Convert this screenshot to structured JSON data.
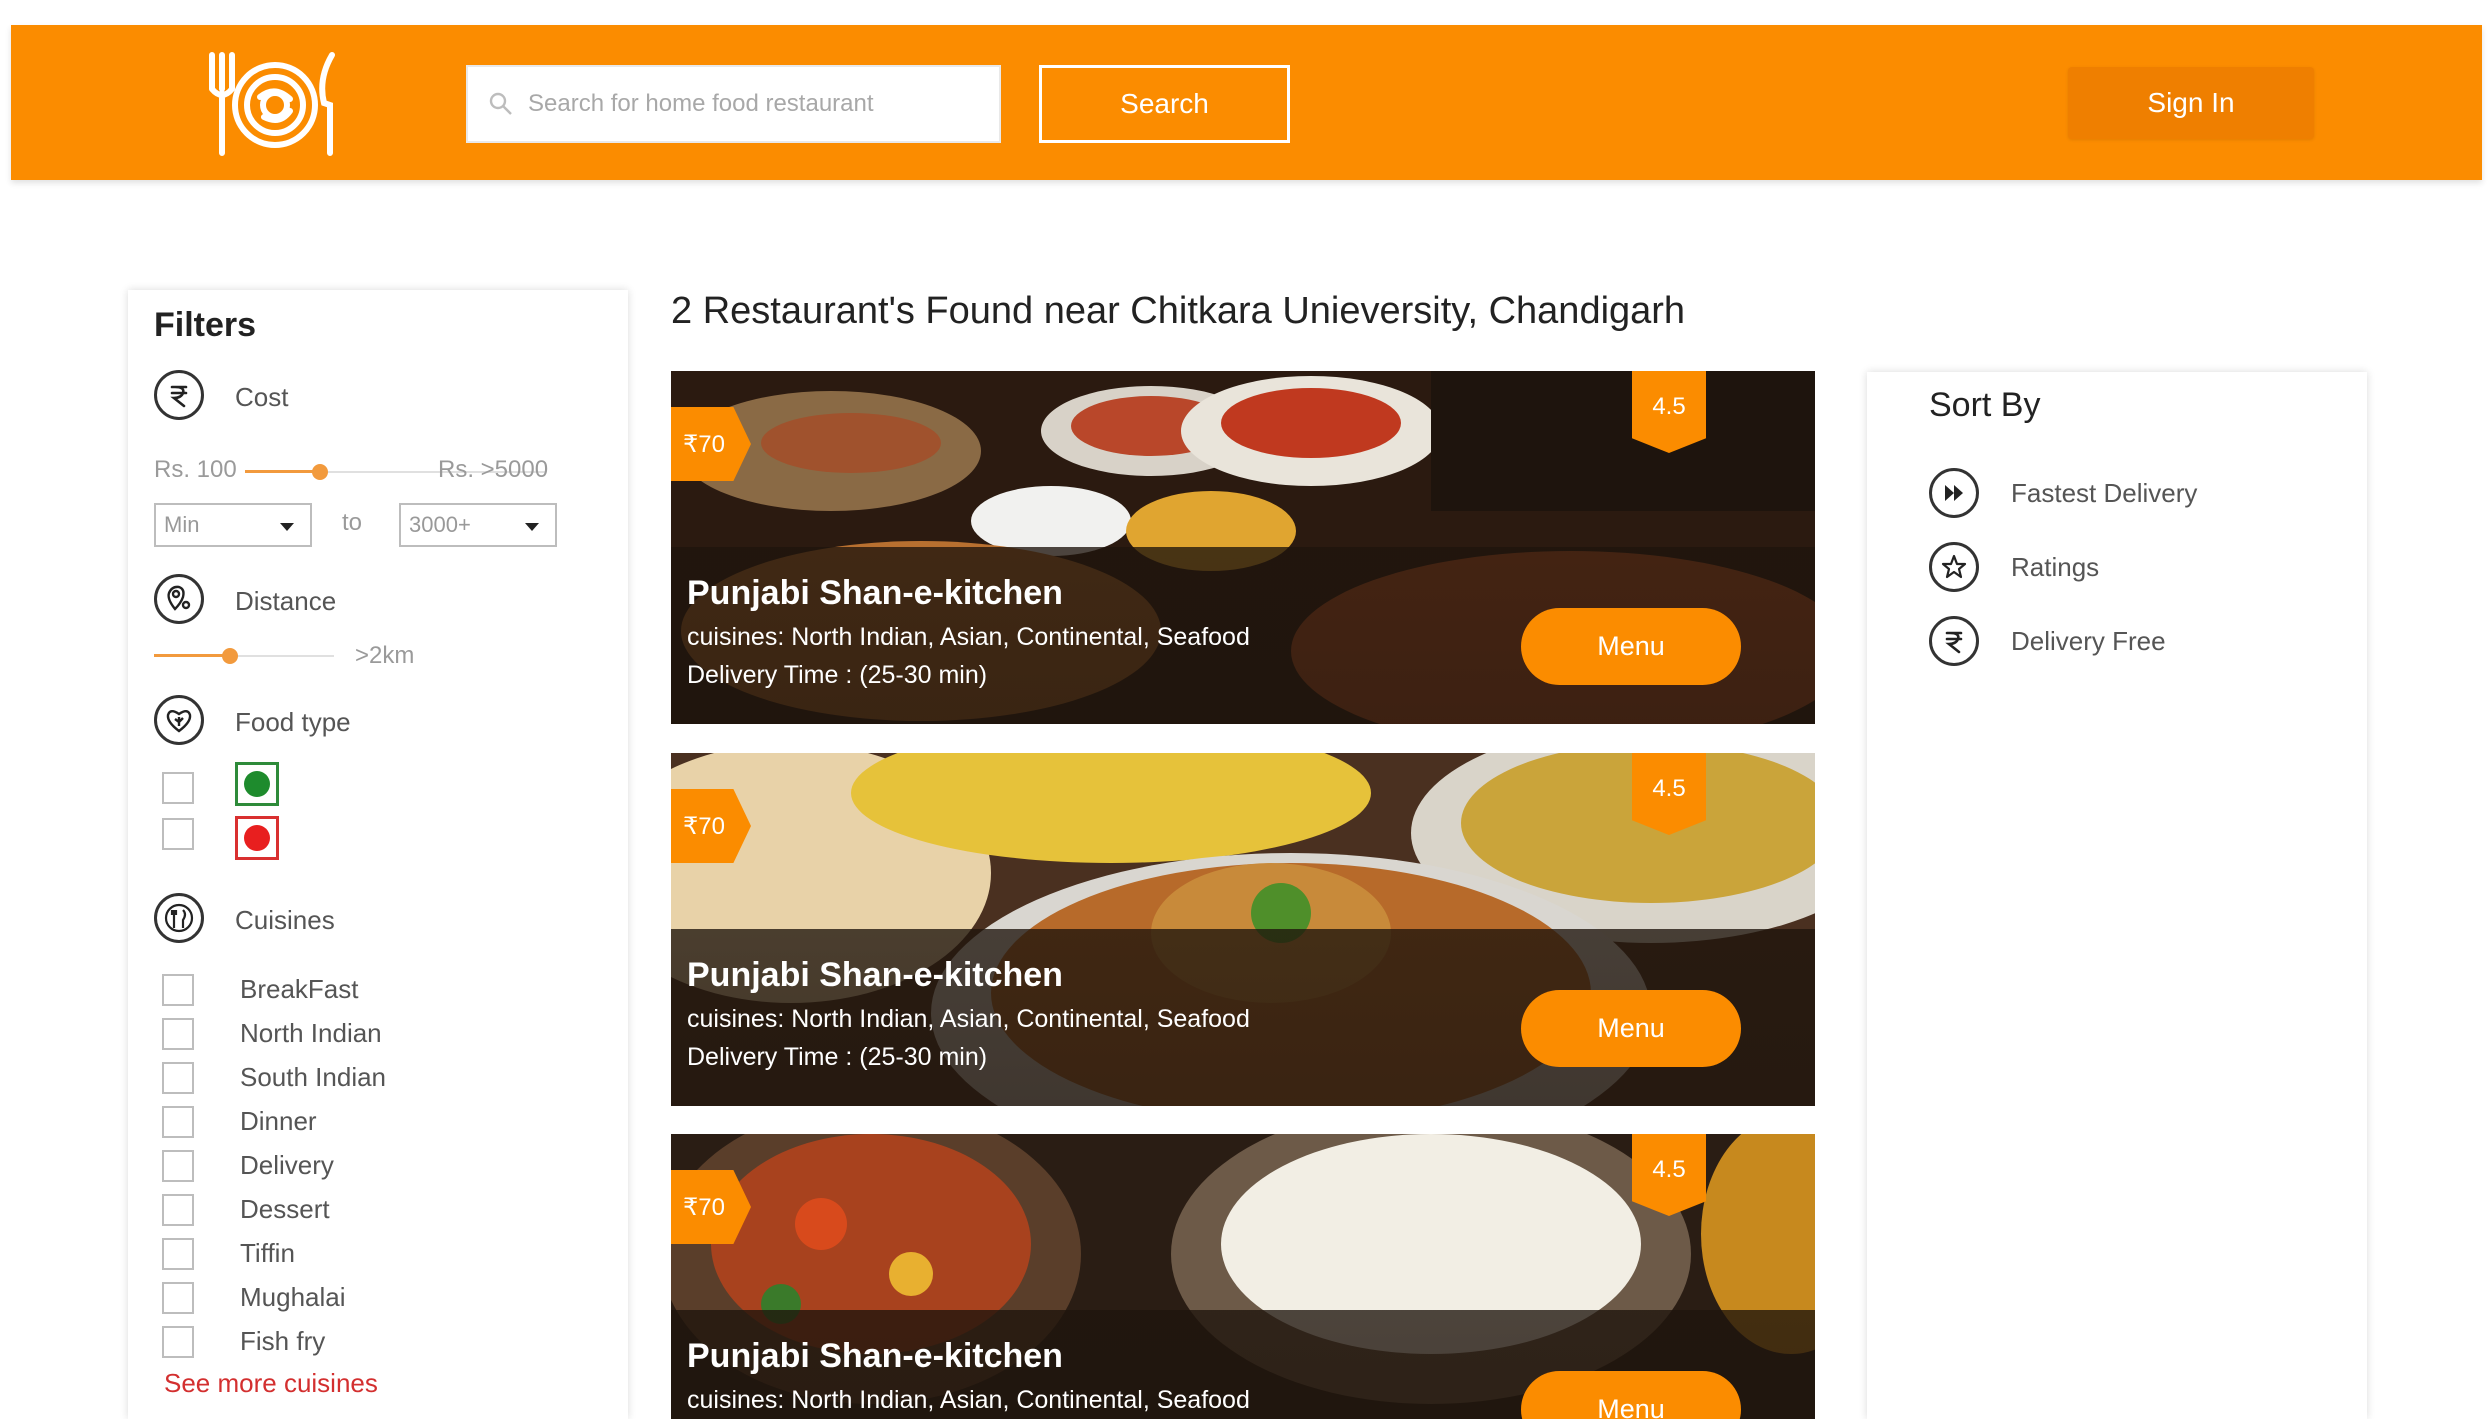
{
  "header": {
    "search_placeholder": "Search for home food restaurant",
    "search_button": "Search",
    "signin_button": "Sign In",
    "brand_color": "#fb8c00"
  },
  "filters": {
    "title": "Filters",
    "cost": {
      "label": "Cost",
      "min_label": "Rs. 100",
      "max_label": "Rs. >5000",
      "min_select": "Min",
      "to_label": "to",
      "max_select": "3000+"
    },
    "distance": {
      "label": "Distance",
      "value_label": ">2km"
    },
    "food_type": {
      "label": "Food type"
    },
    "cuisines": {
      "label": "Cuisines",
      "items": [
        "BreakFast",
        "North Indian",
        "South Indian",
        "Dinner",
        "Delivery",
        "Dessert",
        "Tiffin",
        "Mughalai",
        "Fish fry"
      ],
      "see_more": "See more cuisines"
    }
  },
  "results": {
    "title": "2 Restaurant's Found near Chitkara Unieversity, Chandigarh",
    "cards": [
      {
        "price": "₹70",
        "rating": "4.5",
        "name": "Punjabi Shan-e-kitchen",
        "cuisines": "cuisines: North Indian, Asian, Continental, Seafood",
        "delivery": "Delivery Time :  (25-30 min)",
        "menu_button": "Menu"
      },
      {
        "price": "₹70",
        "rating": "4.5",
        "name": "Punjabi Shan-e-kitchen",
        "cuisines": "cuisines: North Indian, Asian, Continental, Seafood",
        "delivery": "Delivery Time :  (25-30 min)",
        "menu_button": "Menu"
      },
      {
        "price": "₹70",
        "rating": "4.5",
        "name": "Punjabi Shan-e-kitchen",
        "cuisines": "cuisines: North Indian, Asian, Continental, Seafood",
        "delivery": "",
        "menu_button": "Menu"
      }
    ]
  },
  "sort": {
    "title": "Sort By",
    "options": [
      "Fastest Delivery",
      "Ratings",
      "Delivery Free"
    ]
  }
}
